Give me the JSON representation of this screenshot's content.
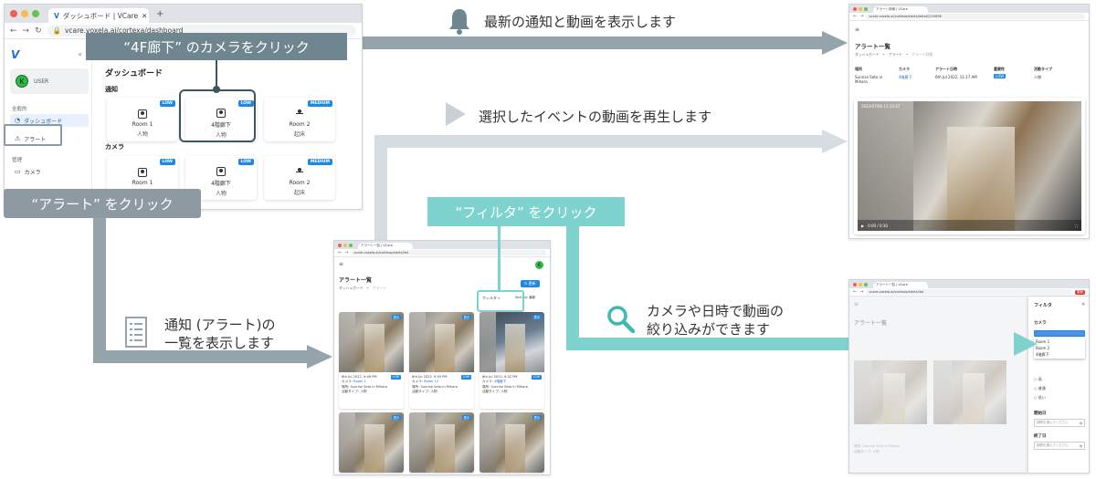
{
  "dashboard_shot": {
    "tab_title": "ダッシュボード | VCare",
    "url": "vcare.voxela.ai/cortexa/dashboard",
    "logo": "V",
    "user": {
      "avatar": "K",
      "name": "USER"
    },
    "nav": {
      "section_all": "全般的",
      "dashboard": "ダッシュボード",
      "alerts": "アラート",
      "section_admin": "管理",
      "camera": "カメラ"
    },
    "page_title": "ダッシュボード",
    "notice_heading": "通知",
    "camera_heading": "カメラ",
    "notices": [
      {
        "name": "Room 1",
        "sub": "人物",
        "badge": "LOW"
      },
      {
        "name": "4階廊下",
        "sub": "人物",
        "badge": "LOW"
      },
      {
        "name": "Room 2",
        "sub": "起床",
        "badge": "MEDIUM"
      }
    ],
    "cameras": [
      {
        "name": "Room 1",
        "sub": "人物",
        "badge": "LOW"
      },
      {
        "name": "4階廊下",
        "sub": "人物",
        "badge": "LOW"
      },
      {
        "name": "Room 2",
        "sub": "起床",
        "badge": "MEDIUM"
      }
    ]
  },
  "callouts": {
    "click_camera": "“4F廊下” のカメラをクリック",
    "click_alert": "“アラート” をクリック",
    "click_filter": "“フィルタ” をクリック"
  },
  "captions": {
    "latest": "最新の通知と動画を表示します",
    "play": "選択したイベントの動画を再生します",
    "list_line1": "通知 (アラート)の",
    "list_line2": "一覧を表示します",
    "filter_line1": "カメラや日時で動画の",
    "filter_line2": "絞り込みができます"
  },
  "detail_shot": {
    "tab_title": "アラート詳細 | VCare",
    "url": "vcare.voxela.ai/cortexa/alerts/detail/225698",
    "title": "アラート一覧",
    "breadcrumb": [
      "ダッシュボード",
      "アラート",
      "アラート詳細"
    ],
    "headers": [
      "場所",
      "カメラ",
      "アラート日時",
      "重要性",
      "活動タイプ"
    ],
    "values": [
      "Sunrise Seto in Mihara",
      "4階廊下",
      "6th Jul 2022, 11:17 AM",
      "LOW",
      "人物"
    ],
    "video_time": "0:00 / 0:30",
    "video_stamp": "2022/07/06 11:13:47"
  },
  "list_shot": {
    "tab_title": "アラート一覧 | VCare",
    "url": "vcare.voxela.ai/cortexa/alerts/list",
    "avatar": "K",
    "title": "アラート一覧",
    "breadcrumb": [
      "ダッシュボード",
      "アラート"
    ],
    "update_btn": "更新",
    "filter_btn": "フィルタ",
    "sort_btn": "Sort By: 最新",
    "items": [
      {
        "date": "6th Jul 2022, 9:46 PM",
        "camera_label": "カメラ:",
        "camera": "Room 1",
        "place": "場所: Sunrise Seto in Mihara",
        "type": "活動タイプ: 人物",
        "badge": "LOW"
      },
      {
        "date": "6th Jul 2022, 9:50 PM",
        "camera_label": "カメラ:",
        "camera": "Room 12",
        "place": "場所: Sunrise Seto in Mihara",
        "type": "活動タイプ: 人物",
        "badge": "LOW"
      },
      {
        "date": "6th Jul 2022, 9:32 PM",
        "camera_label": "カメラ:",
        "camera": "4階廊下",
        "place": "場所: Sunrise Seto in Mihara",
        "type": "活動タイプ: 人物",
        "badge": "LOW"
      }
    ],
    "video_badge": "表示"
  },
  "filter_shot": {
    "tab_title": "アラート一覧 | VCare",
    "url": "vcare.voxela.ai/cortexa/alerts/list",
    "update_btn": "更新",
    "title": "アラート一覧",
    "panel_title": "フィルタ",
    "camera_label": "カメラ",
    "camera_options": [
      "Room 1",
      "Room 2",
      "4階廊下"
    ],
    "severity_options": [
      "高",
      "普通",
      "低い"
    ],
    "start_label": "開始日",
    "end_label": "終了日",
    "date_placeholder": "期間を選んでください",
    "item_place": "場所: Sunrise Seto in Mihara",
    "item_type": "活動タイプ: 人物"
  },
  "colors": {
    "callout_dark": "#6f858f",
    "arrow_gray": "#95a3ab",
    "arrow_light": "#d6dde1",
    "teal": "#7fd3cf",
    "badge_blue": "#1e88e5",
    "avatar_green": "#2fb84a"
  }
}
